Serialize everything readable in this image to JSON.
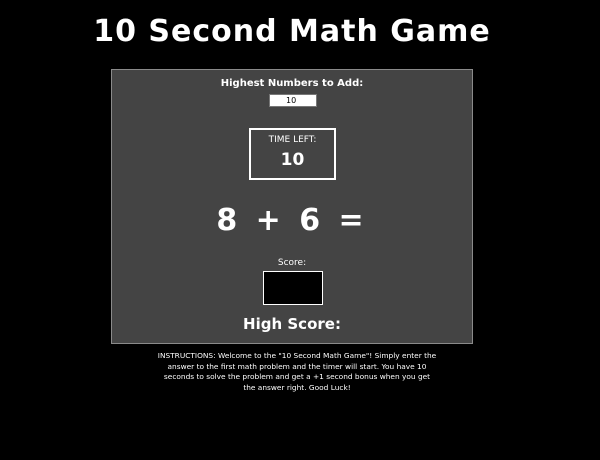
{
  "game": {
    "title": "10 Second Math Game",
    "max_label": "Highest Numbers to Add:",
    "max_value": "10",
    "timer": {
      "label": "TIME LEFT:",
      "value": "10"
    },
    "problem": "8 + 6 =",
    "score_label": "Score:",
    "score_value": "",
    "high_score_label": "High Score:",
    "instructions": "INSTRUCTIONS: Welcome to the \"10 Second Math Game\"! Simply enter the answer to the first math problem and the timer will start. You have 10 seconds to solve the problem and get a +1 second bonus when you get the answer right. Good Luck!"
  },
  "colors": {
    "page_background": "#000000",
    "panel_background": "#444444",
    "text": "#ffffff"
  }
}
